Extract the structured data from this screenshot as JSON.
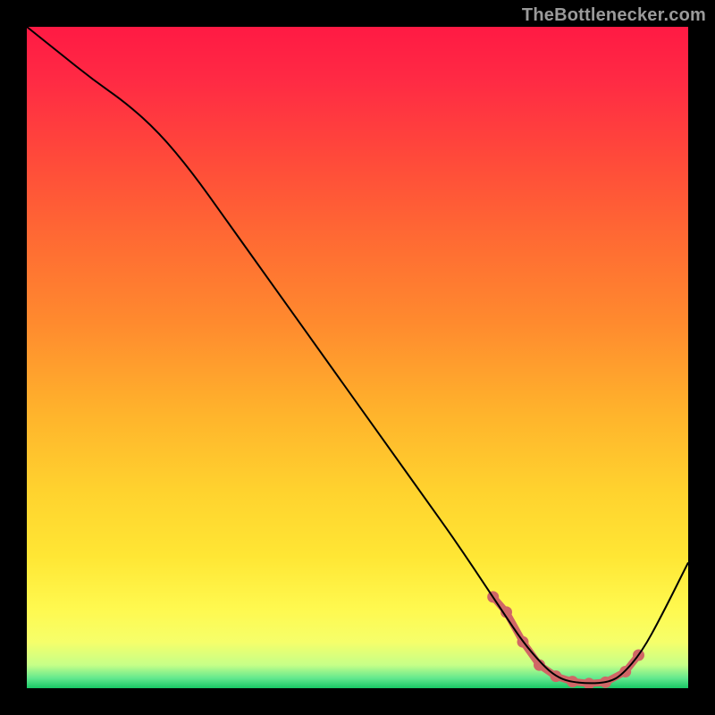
{
  "watermark": "TheBottlenecker.com",
  "colors": {
    "black": "#000000",
    "curve_stroke": "#000000",
    "band_line": "#d06666",
    "band_dot": "#d06666",
    "gradient_stops": [
      {
        "offset": 0.0,
        "color": "#ff1a44"
      },
      {
        "offset": 0.08,
        "color": "#ff2a44"
      },
      {
        "offset": 0.2,
        "color": "#ff4a3a"
      },
      {
        "offset": 0.32,
        "color": "#ff6a33"
      },
      {
        "offset": 0.45,
        "color": "#ff8b2e"
      },
      {
        "offset": 0.58,
        "color": "#ffb22c"
      },
      {
        "offset": 0.7,
        "color": "#ffd22e"
      },
      {
        "offset": 0.8,
        "color": "#ffe634"
      },
      {
        "offset": 0.88,
        "color": "#fff94f"
      },
      {
        "offset": 0.93,
        "color": "#f6ff6a"
      },
      {
        "offset": 0.965,
        "color": "#c6ff88"
      },
      {
        "offset": 0.985,
        "color": "#62e88e"
      },
      {
        "offset": 1.0,
        "color": "#18c765"
      }
    ]
  },
  "chart_data": {
    "type": "line",
    "title": "",
    "xlabel": "",
    "ylabel": "",
    "xlim": [
      0,
      100
    ],
    "ylim": [
      0,
      100
    ],
    "grid": false,
    "legend": false,
    "series": [
      {
        "name": "bottleneck-curve",
        "x": [
          0,
          5,
          10,
          15,
          20,
          25,
          30,
          35,
          40,
          45,
          50,
          55,
          60,
          65,
          70,
          72,
          75,
          78,
          80,
          82,
          85,
          88,
          90,
          93,
          96,
          100
        ],
        "y": [
          100,
          96,
          92,
          88.5,
          84,
          78,
          71,
          64,
          57,
          50,
          43,
          36,
          29,
          22,
          14.5,
          11.5,
          7,
          3.5,
          1.8,
          1.0,
          0.7,
          0.9,
          2.0,
          5.5,
          11,
          19
        ]
      }
    ],
    "optimal_band": {
      "name": "optimal-range-markers",
      "x": [
        70.5,
        72.5,
        75.0,
        77.5,
        80.0,
        82.5,
        85.0,
        87.5,
        90.5,
        92.5
      ],
      "y": [
        13.8,
        11.5,
        7.0,
        3.5,
        1.8,
        1.0,
        0.7,
        0.9,
        2.5,
        5.0
      ]
    }
  }
}
